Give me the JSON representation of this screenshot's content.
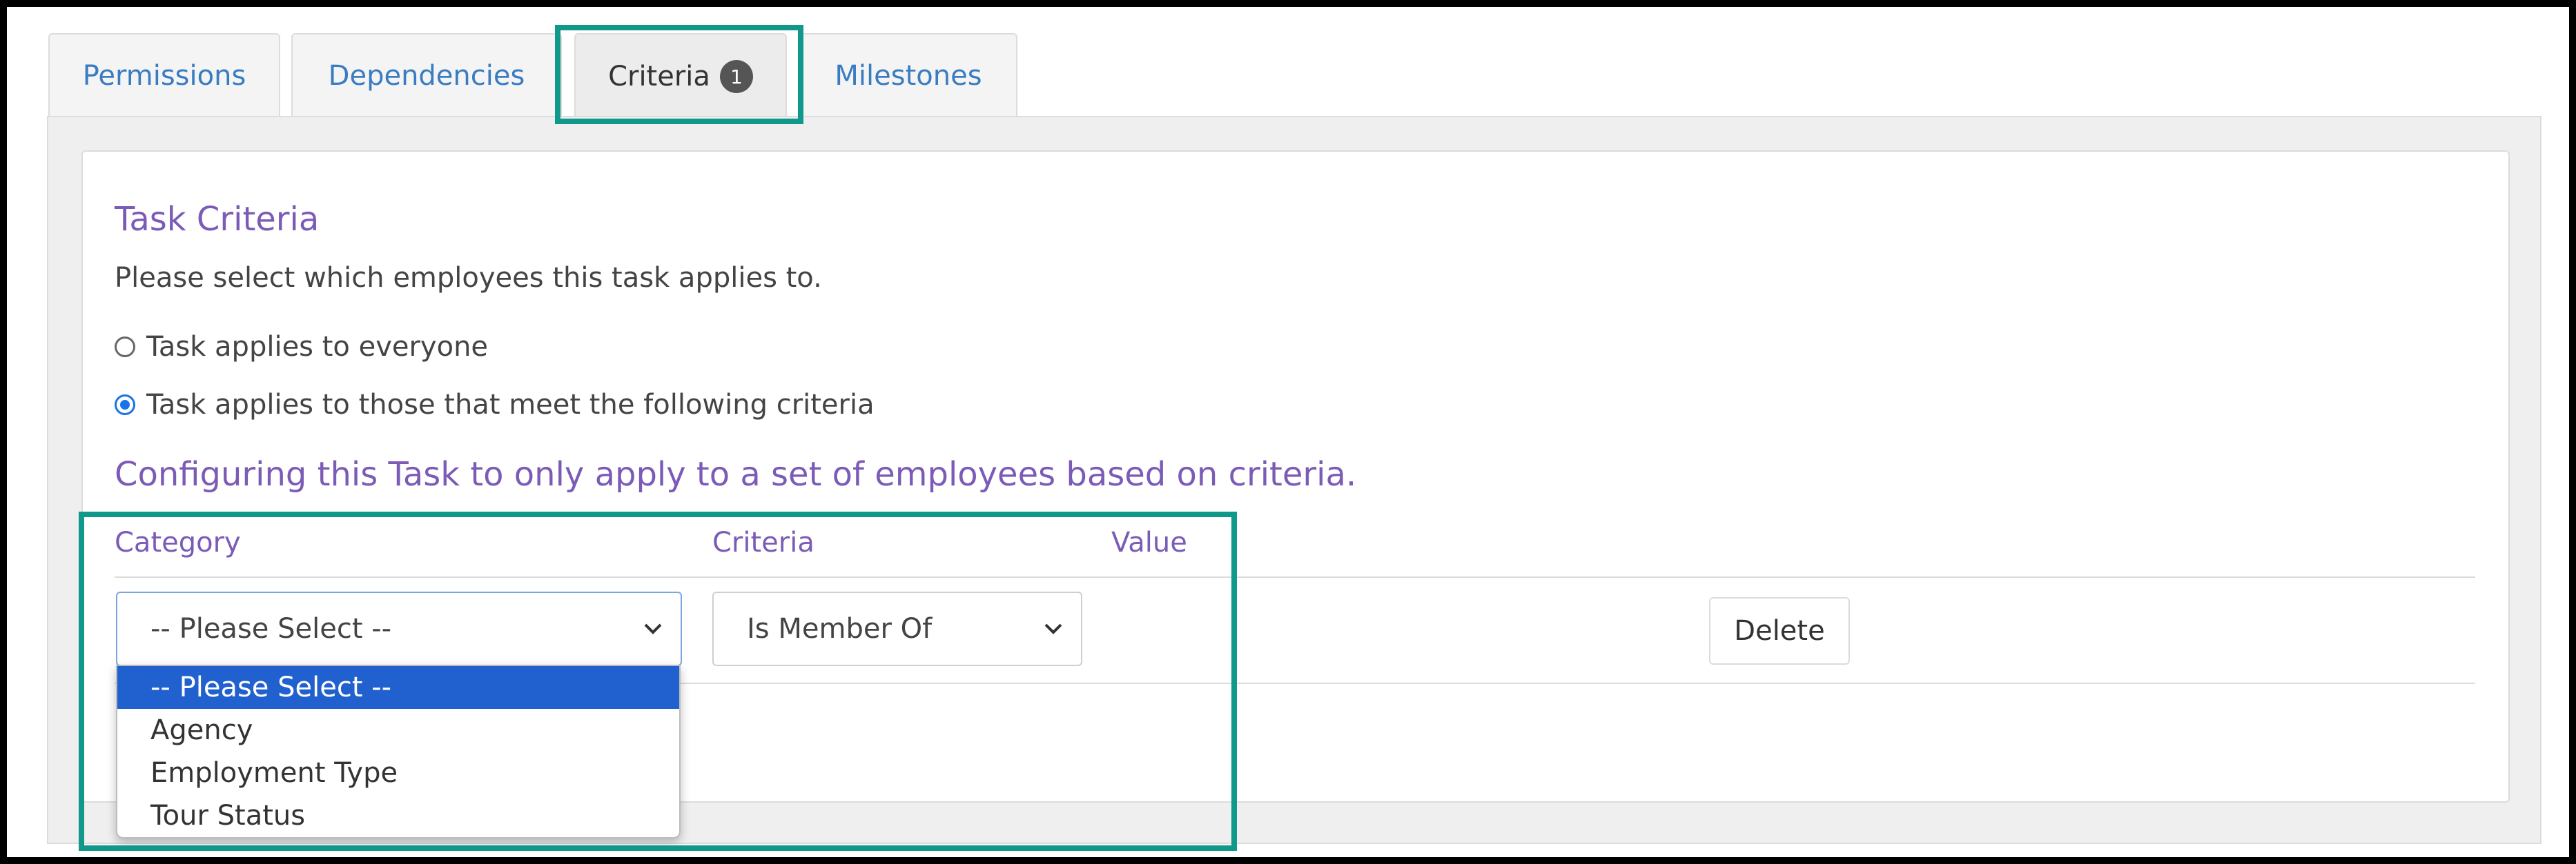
{
  "tabs": [
    {
      "label": "Permissions"
    },
    {
      "label": "Dependencies"
    },
    {
      "label": "Criteria",
      "badge": "1",
      "active": true
    },
    {
      "label": "Milestones"
    }
  ],
  "task_criteria": {
    "title": "Task Criteria",
    "description": "Please select which employees this task applies to.",
    "options": [
      {
        "label": "Task applies to everyone",
        "checked": false
      },
      {
        "label": "Task applies to those that meet the following criteria",
        "checked": true
      }
    ],
    "config_heading": "Configuring this Task to only apply to a set of employees based on criteria."
  },
  "table": {
    "headers": [
      "Category",
      "Criteria",
      "Value"
    ],
    "row": {
      "category_value": "-- Please Select --",
      "criteria_value": "Is Member Of",
      "delete_label": "Delete"
    }
  },
  "category_dropdown": {
    "options": [
      "-- Please Select --",
      "Agency",
      "Employment Type",
      "Tour Status"
    ],
    "selected_index": 0
  },
  "colors": {
    "accent_purple": "#7b5bb6",
    "tab_link_blue": "#3a7cc1",
    "highlight_teal": "#10988a",
    "dropdown_selected": "#2160cf"
  }
}
